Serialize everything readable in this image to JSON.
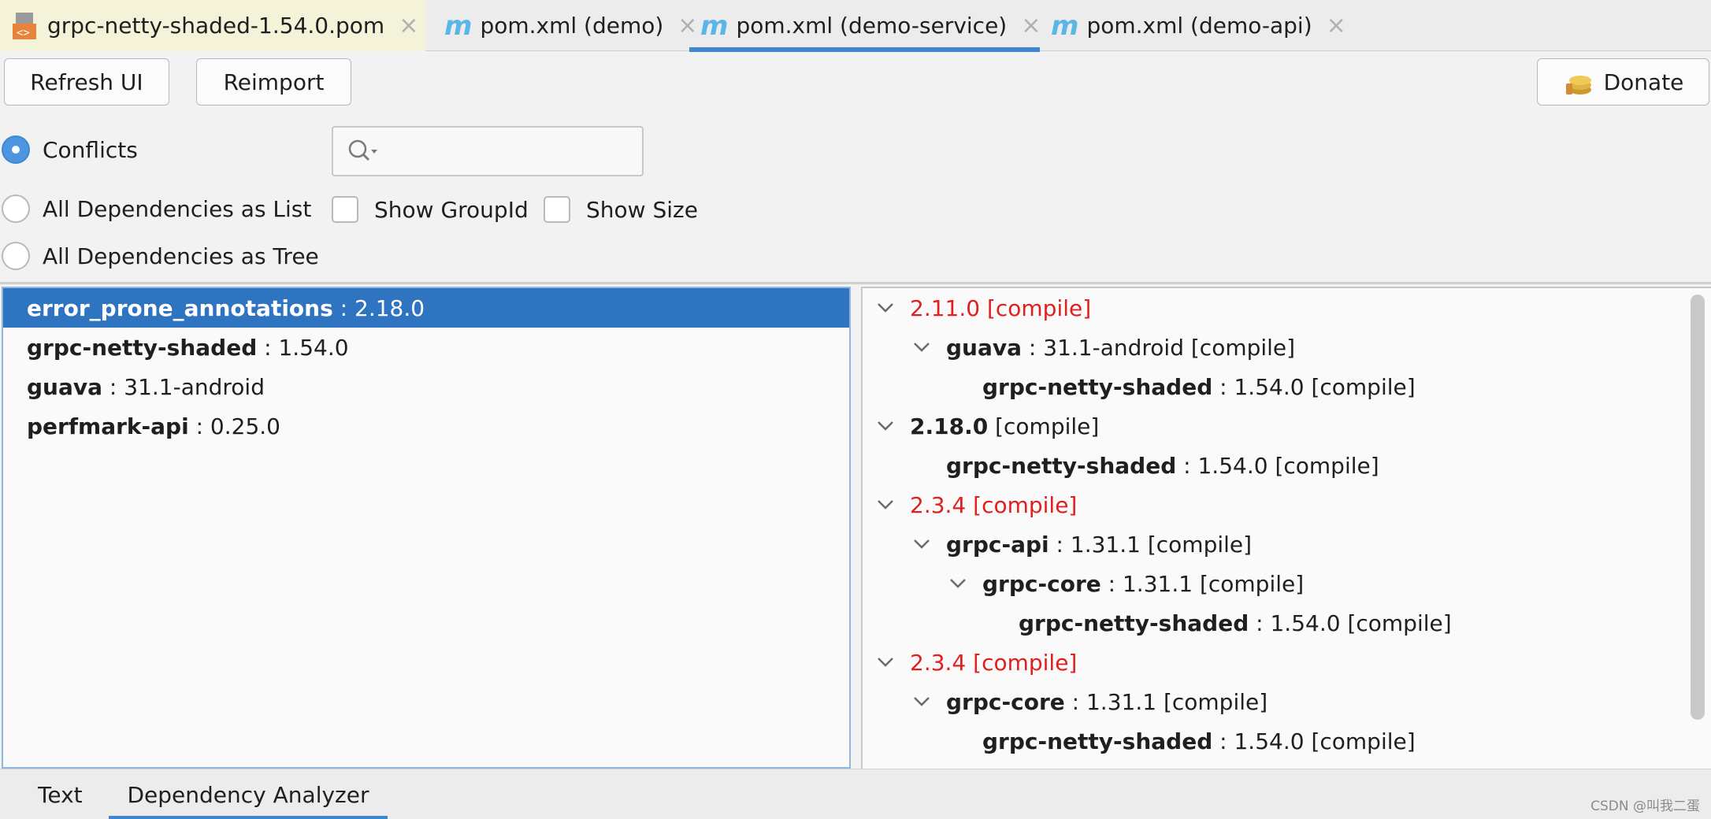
{
  "editor_tabs": [
    {
      "label": "grpc-netty-shaded-1.54.0.pom",
      "icon": "pom-file-icon"
    },
    {
      "label": "pom.xml (demo)",
      "icon": "maven-icon"
    },
    {
      "label": "pom.xml (demo-service)",
      "icon": "maven-icon"
    },
    {
      "label": "pom.xml (demo-api)",
      "icon": "maven-icon"
    }
  ],
  "icon_glyphs": {
    "maven": "m",
    "close": "×"
  },
  "toolbar": {
    "refresh_label": "Refresh UI",
    "reimport_label": "Reimport",
    "donate_label": "Donate"
  },
  "view_modes": {
    "conflicts": "Conflicts",
    "list": "All Dependencies as List",
    "tree": "All Dependencies as Tree",
    "selected": "conflicts"
  },
  "search": {
    "value": ""
  },
  "options": {
    "show_group_id": "Show GroupId",
    "show_size": "Show Size"
  },
  "conflict_list": [
    {
      "name": "error_prone_annotations",
      "version": " : 2.18.0"
    },
    {
      "name": "grpc-netty-shaded",
      "version": " : 1.54.0"
    },
    {
      "name": "guava",
      "version": " : 31.1-android"
    },
    {
      "name": "perfmark-api",
      "version": " : 0.25.0"
    }
  ],
  "dependency_tree": [
    {
      "version": "2.11.0 [compile]",
      "style": "conflict"
    },
    {
      "name": "guava",
      "rest": " : 31.1-android [compile]"
    },
    {
      "name": "grpc-netty-shaded",
      "rest": " : 1.54.0 [compile]"
    },
    {
      "name": "2.18.0",
      "rest": " [compile]"
    },
    {
      "name": "grpc-netty-shaded",
      "rest": " : 1.54.0 [compile]"
    },
    {
      "version": "2.3.4 [compile]",
      "style": "conflict"
    },
    {
      "name": "grpc-api",
      "rest": " : 1.31.1 [compile]"
    },
    {
      "name": "grpc-core",
      "rest": " : 1.31.1 [compile]"
    },
    {
      "name": "grpc-netty-shaded",
      "rest": " : 1.54.0 [compile]"
    },
    {
      "version": "2.3.4 [compile]",
      "style": "conflict"
    },
    {
      "name": "grpc-core",
      "rest": " : 1.31.1 [compile]"
    },
    {
      "name": "grpc-netty-shaded",
      "rest": " : 1.54.0 [compile]"
    }
  ],
  "bottom_tabs": {
    "text": "Text",
    "analyzer": "Dependency Analyzer"
  },
  "watermark": "CSDN @叫我二蛋",
  "colors": {
    "accent": "#3f87cf",
    "selection": "#2f74c0",
    "conflict": "#e0201e"
  }
}
